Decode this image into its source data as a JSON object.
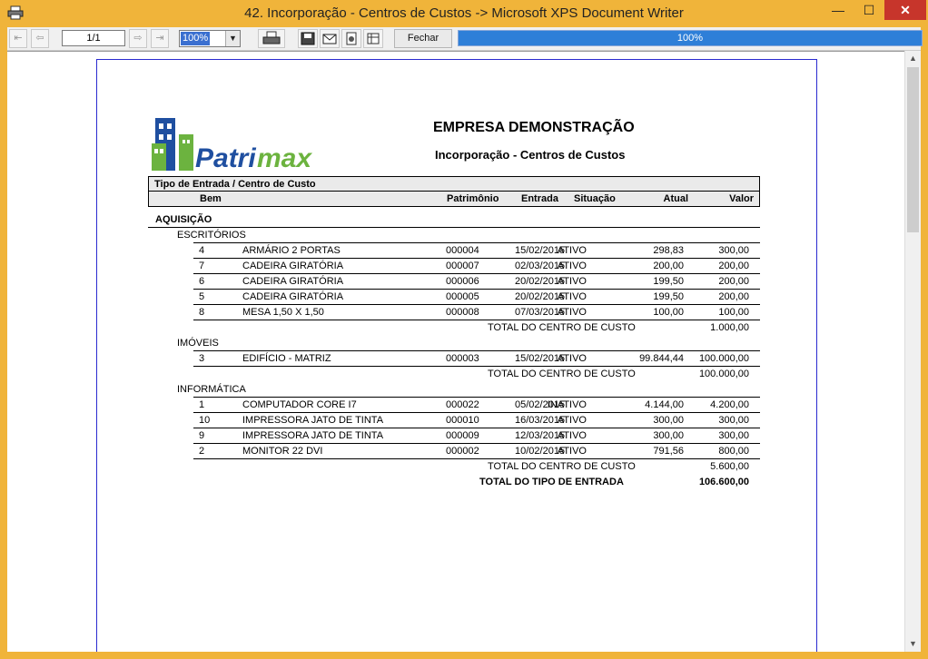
{
  "window": {
    "title": "42. Incorporação - Centros de Custos -> Microsoft XPS Document Writer",
    "minimize": "—",
    "maximize": "☐",
    "close": "✕"
  },
  "toolbar": {
    "page": "1/1",
    "zoom": "100%",
    "close_label": "Fechar",
    "progress_text": "100%",
    "progress": 100
  },
  "report": {
    "company": "EMPRESA DEMONSTRAÇÃO",
    "title": "Incorporação - Centros de Custos",
    "logo_text": "Patrimax",
    "header": {
      "group": "Tipo de Entrada / Centro de Custo",
      "bem": "Bem",
      "patrimonio": "Patrimônio",
      "entrada": "Entrada",
      "situacao": "Situação",
      "atual": "Atual",
      "valor": "Valor"
    },
    "type_name": "AQUISIÇÃO",
    "cc": [
      {
        "name": "ESCRITÓRIOS",
        "total_label": "TOTAL DO CENTRO DE CUSTO",
        "total": "1.000,00",
        "rows": [
          {
            "bem": "4",
            "desc": "ARMÁRIO 2 PORTAS",
            "pat": "000004",
            "data": "15/02/2015",
            "sit": "ATIVO",
            "atual": "298,83",
            "valor": "300,00"
          },
          {
            "bem": "7",
            "desc": "CADEIRA GIRATÓRIA",
            "pat": "000007",
            "data": "02/03/2015",
            "sit": "ATIVO",
            "atual": "200,00",
            "valor": "200,00"
          },
          {
            "bem": "6",
            "desc": "CADEIRA GIRATÓRIA",
            "pat": "000006",
            "data": "20/02/2015",
            "sit": "ATIVO",
            "atual": "199,50",
            "valor": "200,00"
          },
          {
            "bem": "5",
            "desc": "CADEIRA GIRATÓRIA",
            "pat": "000005",
            "data": "20/02/2015",
            "sit": "ATIVO",
            "atual": "199,50",
            "valor": "200,00"
          },
          {
            "bem": "8",
            "desc": "MESA 1,50 X 1,50",
            "pat": "000008",
            "data": "07/03/2015",
            "sit": "ATIVO",
            "atual": "100,00",
            "valor": "100,00"
          }
        ]
      },
      {
        "name": "IMÓVEIS",
        "total_label": "TOTAL DO CENTRO DE CUSTO",
        "total": "100.000,00",
        "rows": [
          {
            "bem": "3",
            "desc": "EDIFÍCIO - MATRIZ",
            "pat": "000003",
            "data": "15/02/2015",
            "sit": "ATIVO",
            "atual": "99.844,44",
            "valor": "100.000,00"
          }
        ]
      },
      {
        "name": "INFORMÁTICA",
        "total_label": "TOTAL DO CENTRO DE CUSTO",
        "total": "5.600,00",
        "rows": [
          {
            "bem": "1",
            "desc": "COMPUTADOR CORE I7",
            "pat": "000022",
            "data": "05/02/2015",
            "sit": "INATIVO",
            "atual": "4.144,00",
            "valor": "4.200,00"
          },
          {
            "bem": "10",
            "desc": "IMPRESSORA JATO DE TINTA",
            "pat": "000010",
            "data": "16/03/2015",
            "sit": "ATIVO",
            "atual": "300,00",
            "valor": "300,00"
          },
          {
            "bem": "9",
            "desc": "IMPRESSORA JATO DE TINTA",
            "pat": "000009",
            "data": "12/03/2015",
            "sit": "ATIVO",
            "atual": "300,00",
            "valor": "300,00"
          },
          {
            "bem": "2",
            "desc": "MONITOR 22 DVI",
            "pat": "000002",
            "data": "10/02/2015",
            "sit": "ATIVO",
            "atual": "791,56",
            "valor": "800,00"
          }
        ]
      }
    ],
    "type_total_label": "TOTAL DO TIPO DE ENTRADA",
    "type_total": "106.600,00"
  }
}
